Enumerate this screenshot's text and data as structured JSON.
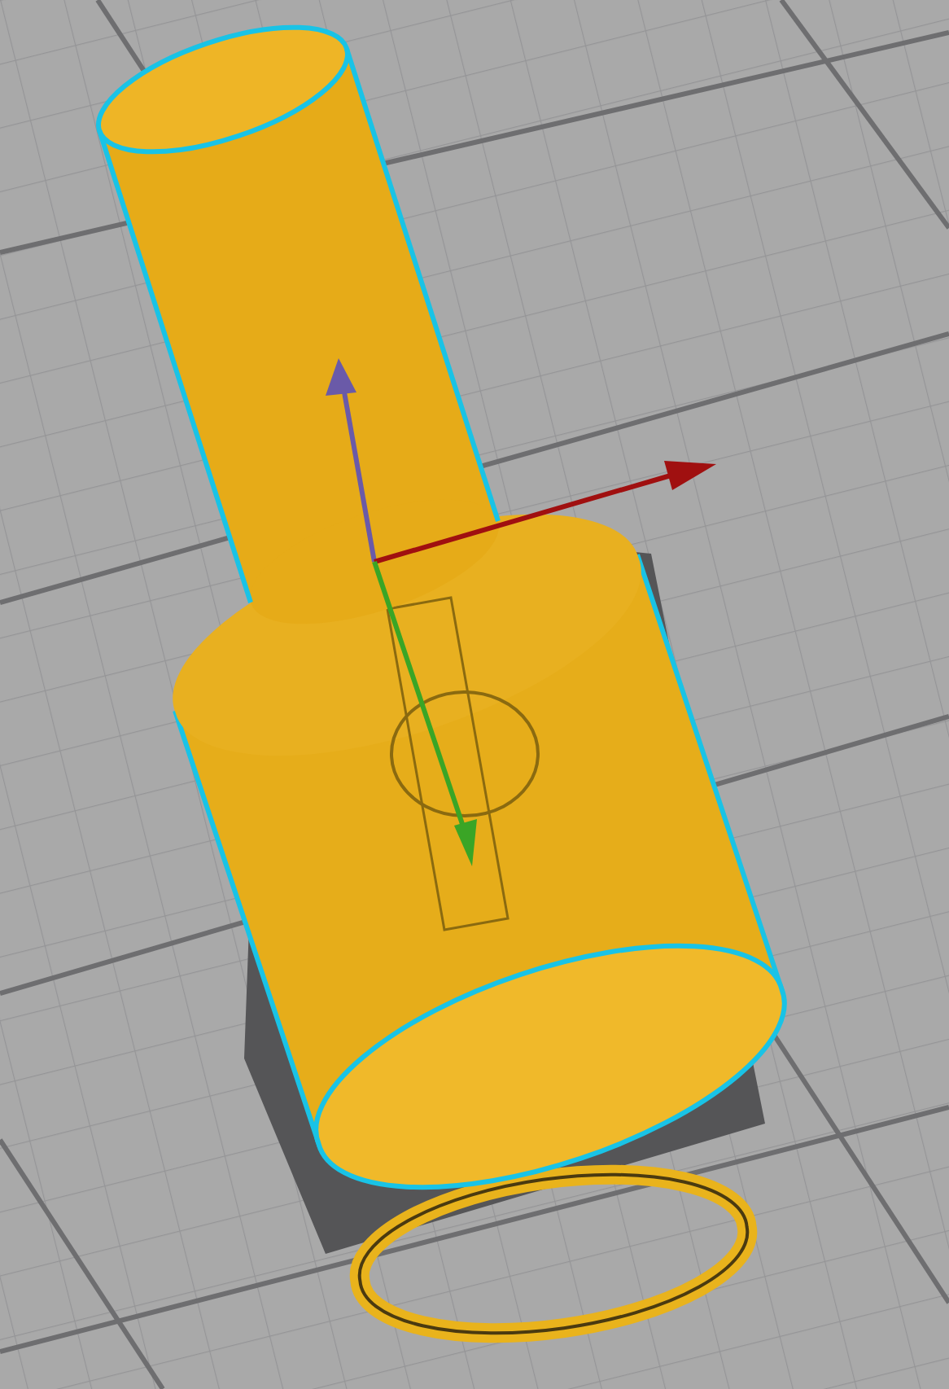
{
  "viewport": {
    "grid": true,
    "gizmo": true
  }
}
